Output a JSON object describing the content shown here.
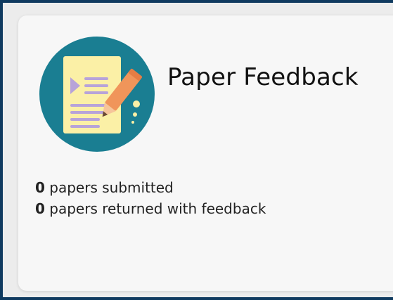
{
  "card": {
    "title": "Paper Feedback",
    "icon": "paper-pencil-icon",
    "stats": [
      {
        "count": "0",
        "label": "papers submitted"
      },
      {
        "count": "0",
        "label": "papers returned with feedback"
      }
    ]
  },
  "colors": {
    "frame_border": "#0f3a5f",
    "icon_circle": "#1a7e92",
    "paper": "#fbf0a6",
    "pencil": "#f0955a",
    "lines": "#b7a3d9"
  }
}
